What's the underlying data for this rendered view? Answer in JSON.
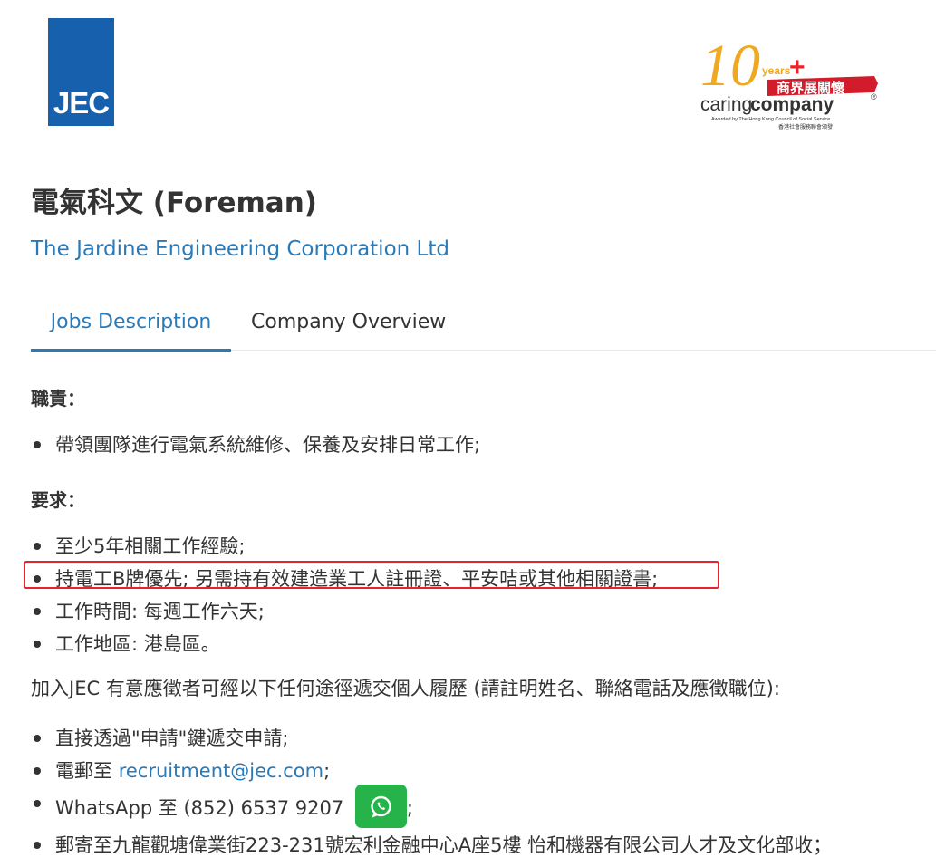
{
  "header": {
    "company_logo_text": "JEC",
    "caring_logo": {
      "years": "10",
      "years_word": "years",
      "plus": "+",
      "chinese_banner": "商界展關懷",
      "caring_word": "caring",
      "company_word": "company",
      "registered": "®",
      "awarded_line": "Awarded by The Hong Kong Council of Social Service",
      "awarded_line_zh": "香港社會服務聯會頒發"
    }
  },
  "job": {
    "title": "電氣科文 (Foreman)",
    "company": "The Jardine Engineering Corporation Ltd"
  },
  "tabs": [
    {
      "label": "Jobs Description",
      "active": true
    },
    {
      "label": "Company Overview",
      "active": false
    }
  ],
  "description": {
    "duties_heading": "職責：",
    "duties": [
      "帶領團隊進行電氣系統維修、保養及安排日常工作;"
    ],
    "requirements_heading": "要求：",
    "requirements": [
      "至少5年相關工作經驗;",
      "持電工B牌優先; 另需持有效建造業工人註冊證、平安咭或其他相關證書;",
      "工作時間: 每週工作六天;",
      "工作地區: 港島區。"
    ],
    "apply_intro": "加入JEC 有意應徵者可經以下任何途徑遞交個人履歷 (請註明姓名、聯絡電話及應徵職位):",
    "apply_methods": {
      "direct": "直接透過\"申請\"鍵遞交申請;",
      "email_prefix": "電郵至 ",
      "email": "recruitment@jec.com",
      "email_suffix": ";",
      "whatsapp_prefix": "WhatsApp 至 (852) 6537 9207 ",
      "whatsapp_suffix": ";",
      "mail": "郵寄至九龍觀塘偉業街223-231號宏利金融中心A座5樓 怡和機器有限公司人才及文化部收；"
    }
  },
  "colors": {
    "brand_blue": "#1660ae",
    "link_blue": "#2a7ab8",
    "highlight_red": "#e8232a",
    "whatsapp_green": "#25b34a"
  },
  "icons": {
    "whatsapp": "whatsapp-icon"
  }
}
